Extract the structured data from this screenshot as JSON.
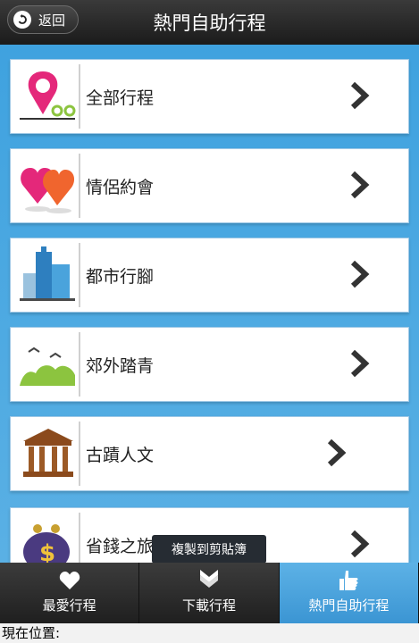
{
  "header": {
    "back_label": "返回",
    "title": "熱門自助行程"
  },
  "items": [
    {
      "label": "全部行程",
      "icon": "map-pin-icon"
    },
    {
      "label": "情侶約會",
      "icon": "hearts-icon"
    },
    {
      "label": "都市行腳",
      "icon": "city-buildings-icon"
    },
    {
      "label": "郊外踏青",
      "icon": "countryside-icon"
    },
    {
      "label": "古蹟人文",
      "icon": "temple-icon"
    },
    {
      "label": "省錢之旅",
      "icon": "money-bag-icon"
    }
  ],
  "toast": "複製到剪貼簿",
  "tabs": [
    {
      "label": "最愛行程",
      "icon": "heart-icon"
    },
    {
      "label": "下載行程",
      "icon": "download-icon"
    },
    {
      "label": "熱門自助行程",
      "icon": "thumbs-up-icon",
      "active": true
    }
  ],
  "status": "現在位置:",
  "colors": {
    "accent": "#4aa6dc",
    "header": "#1f1f1f",
    "active_tab": "#4fa8e0"
  }
}
